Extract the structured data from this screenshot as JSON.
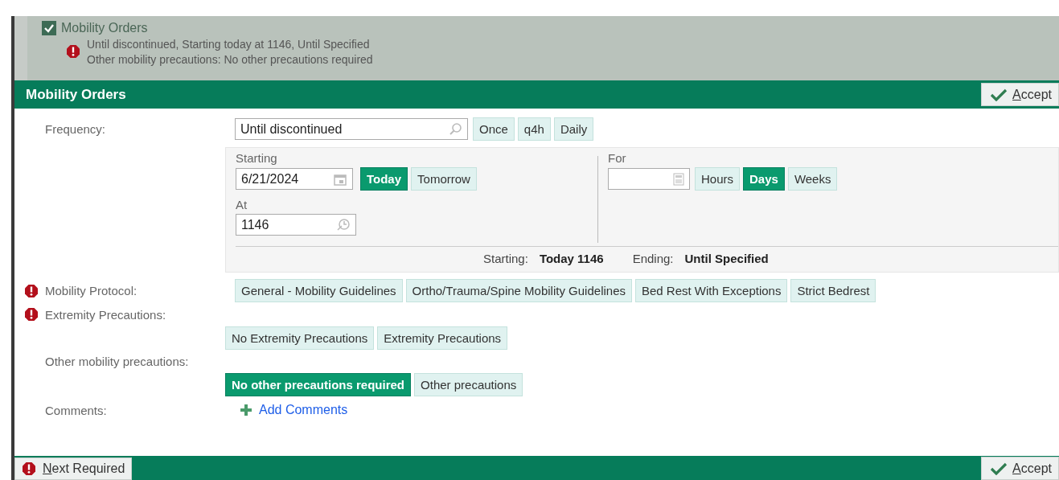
{
  "summary": {
    "checked": true,
    "title": "Mobility Orders",
    "required": true,
    "lines": [
      "Until discontinued, Starting today at 1146, Until Specified",
      "Other mobility precautions: No other precautions required"
    ]
  },
  "form": {
    "title": "Mobility Orders",
    "accept": "Accept"
  },
  "frequency": {
    "label": "Frequency:",
    "value": "Until discontinued",
    "options": [
      {
        "label": "Once",
        "selected": false
      },
      {
        "label": "q4h",
        "selected": false
      },
      {
        "label": "Daily",
        "selected": false
      }
    ]
  },
  "starting": {
    "label": "Starting",
    "date": "6/21/2024",
    "options": [
      {
        "label": "Today",
        "selected": true
      },
      {
        "label": "Tomorrow",
        "selected": false
      }
    ],
    "at_label": "At",
    "time": "1146"
  },
  "duration": {
    "label": "For",
    "options": [
      {
        "label": "Hours",
        "selected": false
      },
      {
        "label": "Days",
        "selected": true
      },
      {
        "label": "Weeks",
        "selected": false
      }
    ]
  },
  "schedule": {
    "starting_label": "Starting:",
    "starting_value": "Today 1146",
    "ending_label": "Ending:",
    "ending_value": "Until Specified"
  },
  "fields": [
    {
      "kind": "inline",
      "label": "Mobility Protocol:",
      "required": true,
      "options": [
        {
          "label": "General - Mobility Guidelines",
          "selected": false
        },
        {
          "label": "Ortho/Trauma/Spine Mobility Guidelines",
          "selected": false
        },
        {
          "label": "Bed Rest With Exceptions",
          "selected": false
        },
        {
          "label": "Strict Bedrest",
          "selected": false
        }
      ]
    },
    {
      "kind": "stacked",
      "label": "Extremity Precautions:",
      "required": true,
      "options": [
        {
          "label": "No Extremity Precautions",
          "selected": false
        },
        {
          "label": "Extremity Precautions",
          "selected": false
        }
      ]
    },
    {
      "kind": "stacked",
      "label": "Other mobility precautions:",
      "required": false,
      "options": [
        {
          "label": "No other precautions required",
          "selected": true
        },
        {
          "label": "Other precautions",
          "selected": false
        }
      ]
    }
  ],
  "comments": {
    "label": "Comments:",
    "link": "Add Comments"
  },
  "footer": {
    "next": "Next Required",
    "accept": "Accept"
  }
}
